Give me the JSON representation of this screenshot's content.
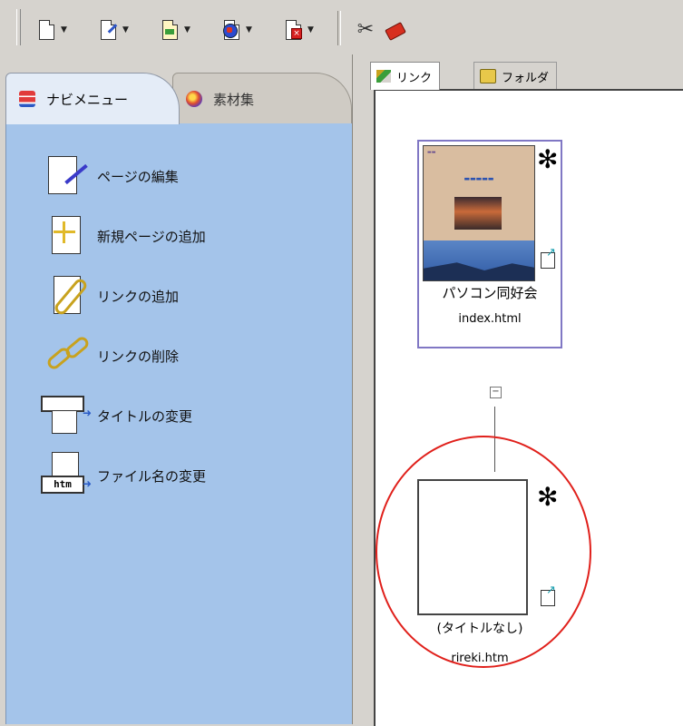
{
  "toolbar": {
    "buttons": [
      {
        "icon": "new-page-icon"
      },
      {
        "icon": "edit-page-icon"
      },
      {
        "icon": "page-properties-icon"
      },
      {
        "icon": "globe-page-icon"
      },
      {
        "icon": "delete-page-icon"
      }
    ],
    "tools": [
      {
        "icon": "scissors-icon"
      },
      {
        "icon": "eraser-icon"
      }
    ]
  },
  "left_panel": {
    "tabs": [
      {
        "label": "ナビメニュー",
        "icon": "nav-menu-icon",
        "active": true
      },
      {
        "label": "素材集",
        "icon": "material-icon",
        "active": false
      }
    ],
    "items": [
      {
        "label": "ページの編集",
        "icon": "edit-page-icon"
      },
      {
        "label": "新規ページの追加",
        "icon": "add-page-icon"
      },
      {
        "label": "リンクの追加",
        "icon": "add-link-icon"
      },
      {
        "label": "リンクの削除",
        "icon": "delete-link-icon"
      },
      {
        "label": "タイトルの変更",
        "icon": "title-change-icon"
      },
      {
        "label": "ファイル名の変更",
        "icon": "filename-change-icon"
      }
    ]
  },
  "right_panel": {
    "tabs": [
      {
        "label": "リンク",
        "icon": "link-tab-icon",
        "active": true
      },
      {
        "label": "フォルダ",
        "icon": "folder-tab-icon",
        "active": false
      }
    ],
    "nodes": [
      {
        "title": "パソコン同好会",
        "file": "index.html",
        "marker": "✻",
        "collapse": "−"
      },
      {
        "title": "(タイトルなし)",
        "file": "rireki.htm",
        "marker": "✻"
      }
    ]
  },
  "colors": {
    "nav_background": "#a4c4ea",
    "highlight": "#e0201b",
    "node_border": "#8077c4"
  }
}
